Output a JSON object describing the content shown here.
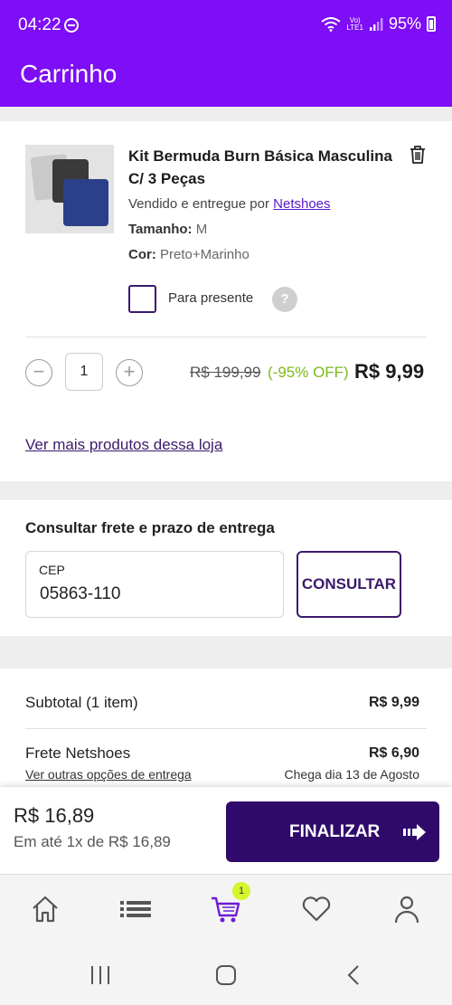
{
  "status": {
    "time": "04:22",
    "battery": "95%",
    "network": "LTE1"
  },
  "header": {
    "title": "Carrinho"
  },
  "product": {
    "name": "Kit Bermuda Burn Básica Masculina C/ 3 Peças",
    "seller_prefix": "Vendido e entregue por",
    "seller_name": "Netshoes",
    "size_label": "Tamanho:",
    "size_value": "M",
    "color_label": "Cor:",
    "color_value": "Preto+Marinho",
    "gift_label": "Para presente",
    "help_symbol": "?",
    "quantity": "1",
    "decrement_symbol": "−",
    "increment_symbol": "+",
    "old_price": "R$ 199,99",
    "discount": "(-95% OFF)",
    "price": "R$ 9,99",
    "more_link": "Ver mais produtos dessa loja"
  },
  "freight": {
    "title": "Consultar frete e prazo de entrega",
    "cep_label": "CEP",
    "cep_value": "05863-110",
    "consult_label": "CONSULTAR"
  },
  "summary": {
    "subtotal_label": "Subtotal (1 item)",
    "subtotal_value": "R$ 9,99",
    "shipping_label": "Frete Netshoes",
    "shipping_value": "R$ 6,90",
    "delivery_options_link": "Ver outras opções de entrega",
    "arrival": "Chega dia 13 de Agosto"
  },
  "checkout": {
    "total": "R$ 16,89",
    "installments": "Em até 1x de R$ 16,89",
    "finalize_label": "FINALIZAR"
  },
  "nav": {
    "cart_badge": "1",
    "items": [
      "home-icon",
      "list-icon",
      "cart-icon",
      "heart-icon",
      "user-icon"
    ]
  },
  "colors": {
    "brand_purple": "#7d0ef5",
    "dark_purple": "#2f0a6b",
    "discount_green": "#7cb81d",
    "badge_yellow": "#d6f52d"
  }
}
